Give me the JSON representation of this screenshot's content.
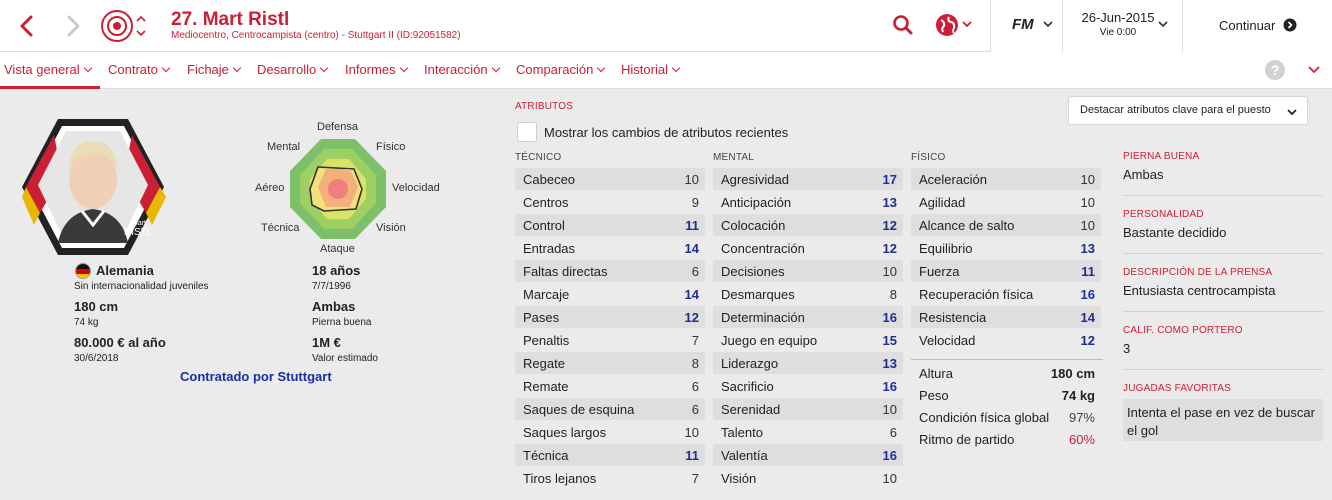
{
  "header": {
    "title": "27. Mart Ristl",
    "subtitle": "Mediocentro, Centrocampista (centro) - Stuttgart II (ID:92051582)",
    "fm_label": "FM",
    "date": "26-Jun-2015",
    "day_time": "Vie 0:00",
    "continue_label": "Continuar"
  },
  "nav": {
    "items": [
      "Vista general",
      "Contrato",
      "Fichaje",
      "Desarrollo",
      "Informes",
      "Interacción",
      "Comparación",
      "Historial"
    ],
    "help": "?"
  },
  "player": {
    "card_name_small": "Mart",
    "card_name_big": "RISTL",
    "nationality": "Alemania",
    "intl": "Sin internacionalidad juveniles",
    "height": "180 cm",
    "weight": "74 kg",
    "wage": "80.000 € al año",
    "contract_end": "30/6/2018",
    "age": "18 años",
    "dob": "7/7/1996",
    "foot": "Ambas",
    "foot_label": "Pierna buena",
    "value": "1M €",
    "value_label": "Valor estimado",
    "contracted": "Contratado por Stuttgart"
  },
  "radar": {
    "labels": {
      "top": "Defensa",
      "tr": "Físico",
      "r": "Velocidad",
      "br": "Visión",
      "bottom": "Ataque",
      "bl": "Técnica",
      "l": "Aéreo",
      "tl": "Mental"
    }
  },
  "attributes": {
    "title": "ATRIBUTOS",
    "highlight_select": "Destacar atributos clave para el puesto",
    "show_changes": "Mostrar los cambios de atributos recientes",
    "technical_title": "TÉCNICO",
    "mental_title": "MENTAL",
    "physical_title": "FÍSICO",
    "technical": [
      [
        "Cabeceo",
        "10"
      ],
      [
        "Centros",
        "9"
      ],
      [
        "Control",
        "11"
      ],
      [
        "Entradas",
        "14"
      ],
      [
        "Faltas directas",
        "6"
      ],
      [
        "Marcaje",
        "14"
      ],
      [
        "Pases",
        "12"
      ],
      [
        "Penaltis",
        "7"
      ],
      [
        "Regate",
        "8"
      ],
      [
        "Remate",
        "6"
      ],
      [
        "Saques de esquina",
        "6"
      ],
      [
        "Saques largos",
        "10"
      ],
      [
        "Técnica",
        "11"
      ],
      [
        "Tiros lejanos",
        "7"
      ]
    ],
    "mental": [
      [
        "Agresividad",
        "17"
      ],
      [
        "Anticipación",
        "13"
      ],
      [
        "Colocación",
        "12"
      ],
      [
        "Concentración",
        "12"
      ],
      [
        "Decisiones",
        "10"
      ],
      [
        "Desmarques",
        "8"
      ],
      [
        "Determinación",
        "16"
      ],
      [
        "Juego en equipo",
        "15"
      ],
      [
        "Liderazgo",
        "13"
      ],
      [
        "Sacrificio",
        "16"
      ],
      [
        "Serenidad",
        "10"
      ],
      [
        "Talento",
        "6"
      ],
      [
        "Valentía",
        "16"
      ],
      [
        "Visión",
        "10"
      ]
    ],
    "physical": [
      [
        "Aceleración",
        "10"
      ],
      [
        "Agilidad",
        "10"
      ],
      [
        "Alcance de salto",
        "10"
      ],
      [
        "Equilibrio",
        "13"
      ],
      [
        "Fuerza",
        "11"
      ],
      [
        "Recuperación física",
        "16"
      ],
      [
        "Resistencia",
        "14"
      ],
      [
        "Velocidad",
        "12"
      ]
    ],
    "extra": [
      [
        "Altura",
        "180 cm"
      ],
      [
        "Peso",
        "74 kg"
      ],
      [
        "Condición física global",
        "97%"
      ],
      [
        "Ritmo de partido",
        "60%"
      ]
    ]
  },
  "side": {
    "foot_h": "PIERNA BUENA",
    "foot_v": "Ambas",
    "pers_h": "PERSONALIDAD",
    "pers_v": "Bastante decidido",
    "press_h": "DESCRIPCIÓN DE LA PRENSA",
    "press_v": "Entusiasta centrocampista",
    "gk_h": "CALIF. COMO PORTERO",
    "gk_v": "3",
    "moves_h": "JUGADAS FAVORITAS",
    "moves_v": "Intenta el pase en vez de buscar el gol"
  },
  "colors": {
    "accent": "#cc1e35",
    "blue_value": "#1a2fa8",
    "red_value": "#cc1e35"
  }
}
